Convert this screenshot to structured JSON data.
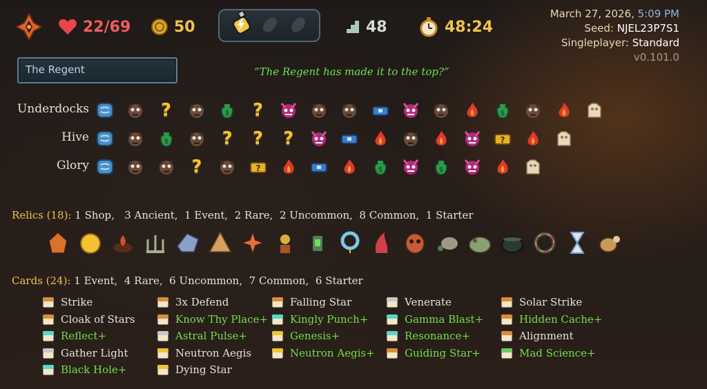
{
  "topbar": {
    "character_icon": "regent-crest-icon",
    "hp": "22/69",
    "gold": "50",
    "potion_slots": [
      "lightning-potion-icon",
      "empty-potion-slot-icon",
      "empty-potion-slot-icon"
    ],
    "floor": "48",
    "run_time": "48:24",
    "date": "March 27, 2026,",
    "time": "5:09 PM",
    "seed_label": "Seed:",
    "seed_value": "NJEL23P7S1",
    "mode_label": "Singleplayer:",
    "mode_value": "Standard",
    "version": "v0.101.0"
  },
  "player_name": "The Regent",
  "quote": "“The Regent has made it to the top?”",
  "acts": [
    {
      "name": "Underdocks",
      "nodes": [
        "ancient-icon",
        "monster-icon",
        "unknown-icon",
        "monster-icon",
        "merchant-icon",
        "unknown-icon",
        "elite-icon",
        "monster-icon",
        "monster-icon",
        "treasure-icon",
        "elite-icon",
        "monster-icon",
        "rest-site-icon",
        "merchant-icon",
        "monster-icon",
        "rest-site-icon",
        "boss-icon"
      ]
    },
    {
      "name": "Hive",
      "nodes": [
        "ancient-icon",
        "monster-icon",
        "merchant-icon",
        "monster-icon",
        "unknown-icon",
        "unknown-icon",
        "unknown-icon",
        "elite-icon",
        "treasure-icon",
        "rest-site-icon",
        "monster-icon",
        "rest-site-icon",
        "elite-icon",
        "unknown-treasure-icon",
        "rest-site-icon",
        "boss-icon"
      ]
    },
    {
      "name": "Glory",
      "nodes": [
        "ancient-icon",
        "monster-icon",
        "monster-icon",
        "unknown-icon",
        "monster-icon",
        "unknown-treasure-icon",
        "rest-site-icon",
        "treasure-icon",
        "rest-site-icon",
        "merchant-icon",
        "elite-icon",
        "merchant-icon",
        "elite-icon",
        "rest-site-icon",
        "boss-icon"
      ]
    }
  ],
  "relics": {
    "heading": "Relics (18):",
    "summary": "1 Shop,   3 Ancient,  1 Event,  2 Rare,  2 Uncommon,  8 Common,  1 Starter",
    "icons": [
      "ember-rock-icon",
      "golden-orb-icon",
      "fire-brazier-icon",
      "candelabra-icon",
      "crystal-shard-icon",
      "paper-fan-icon",
      "shuriken-icon",
      "potted-flower-icon",
      "lantern-icon",
      "bead-necklace-icon",
      "red-horn-icon",
      "mask-icon",
      "rock-critter-icon",
      "frog-statue-icon",
      "cauldron-icon",
      "rainbow-ring-icon",
      "hourglass-icon",
      "barrel-critter-icon"
    ]
  },
  "cards": {
    "heading": "Cards (24):",
    "summary": "1 Event,  4 Rare,  6 Uncommon,  7 Common,  6 Starter",
    "columns": [
      [
        {
          "label": "Strike",
          "up": false,
          "c": "#d88d3a"
        },
        {
          "label": "Cloak of Stars",
          "up": false,
          "c": "#d88d3a"
        },
        {
          "label": "Reflect+",
          "up": true,
          "c": "#5ad6c8"
        },
        {
          "label": "Gather Light",
          "up": false,
          "c": "#c8c8c8"
        },
        {
          "label": "Black Hole+",
          "up": true,
          "c": "#5ad6c8"
        }
      ],
      [
        {
          "label": "3x Defend",
          "up": false,
          "c": "#d88d3a"
        },
        {
          "label": "Know Thy Place+",
          "up": true,
          "c": "#d88d3a"
        },
        {
          "label": "Astral Pulse+",
          "up": true,
          "c": "#c8c8c8"
        },
        {
          "label": "Neutron Aegis",
          "up": false,
          "c": "#f0c430"
        },
        {
          "label": "Dying Star",
          "up": false,
          "c": "#f0c430"
        }
      ],
      [
        {
          "label": "Falling Star",
          "up": false,
          "c": "#d88d3a"
        },
        {
          "label": "Kingly Punch+",
          "up": true,
          "c": "#5ad6c8"
        },
        {
          "label": "Genesis+",
          "up": true,
          "c": "#f0c430"
        },
        {
          "label": "Neutron Aegis+",
          "up": true,
          "c": "#f0c430"
        }
      ],
      [
        {
          "label": "Venerate",
          "up": false,
          "c": "#c8c8c8"
        },
        {
          "label": "Gamma Blast+",
          "up": true,
          "c": "#5ad6c8"
        },
        {
          "label": "Resonance+",
          "up": true,
          "c": "#5ad6c8"
        },
        {
          "label": "Guiding Star+",
          "up": true,
          "c": "#d88d3a"
        }
      ],
      [
        {
          "label": "Solar Strike",
          "up": false,
          "c": "#d88d3a"
        },
        {
          "label": "Hidden Cache+",
          "up": true,
          "c": "#d88d3a"
        },
        {
          "label": "Alignment",
          "up": false,
          "c": "#d88d3a"
        },
        {
          "label": "Mad Science+",
          "up": true,
          "c": "#6ac860"
        }
      ]
    ]
  }
}
